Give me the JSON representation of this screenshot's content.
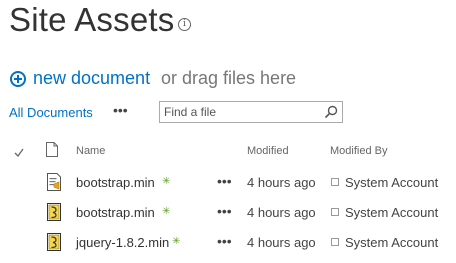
{
  "page": {
    "title": "Site Assets",
    "info_icon": "i"
  },
  "command": {
    "new_document": "new document",
    "drag_text": "or drag files here"
  },
  "views": {
    "current": "All Documents",
    "more": "•••"
  },
  "search": {
    "placeholder": "Find a file"
  },
  "columns": {
    "name": "Name",
    "modified": "Modified",
    "modified_by": "Modified By"
  },
  "rows": [
    {
      "icon": "js-file-icon",
      "name": "bootstrap.min",
      "new_marker": "✳",
      "ellipsis": "•••",
      "modified": "4 hours ago",
      "modified_by": "System Account"
    },
    {
      "icon": "js-file-icon",
      "name": "bootstrap.min",
      "new_marker": "✳",
      "ellipsis": "•••",
      "modified": "4 hours ago",
      "modified_by": "System Account"
    },
    {
      "icon": "js-file-icon",
      "name": "jquery-1.8.2.min",
      "new_marker": "✳",
      "ellipsis": "•••",
      "modified": "4 hours ago",
      "modified_by": "System Account"
    }
  ],
  "colors": {
    "accent": "#0072c6",
    "new_marker": "#5a9e22"
  }
}
